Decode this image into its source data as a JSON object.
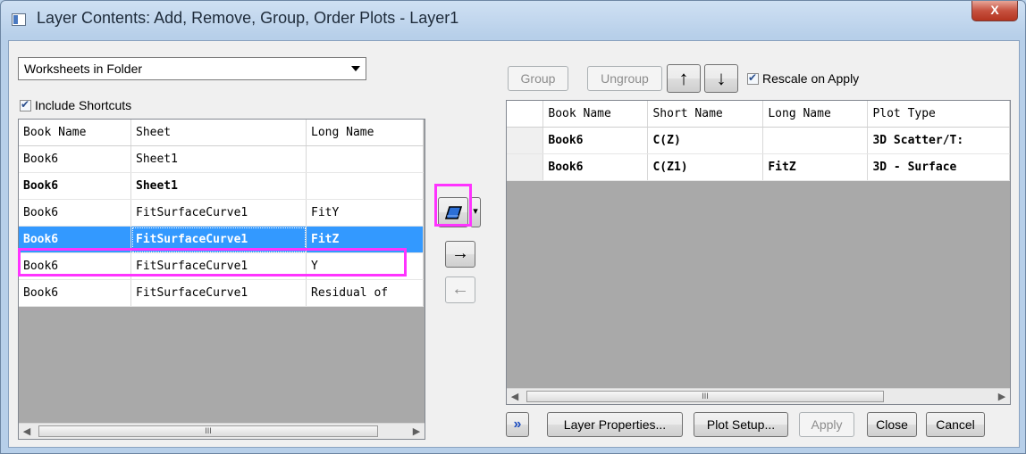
{
  "window": {
    "title": "Layer Contents: Add, Remove, Group, Order Plots - Layer1",
    "close_label": "X"
  },
  "left": {
    "source_select": "Worksheets in Folder",
    "include_shortcuts": {
      "label": "Include Shortcuts",
      "checked": true
    },
    "columns": [
      "Book Name",
      "Sheet",
      "Long Name"
    ],
    "rows": [
      [
        "Book6",
        "Sheet1",
        ""
      ],
      [
        "Book6",
        "Sheet1",
        ""
      ],
      [
        "Book6",
        "FitSurfaceCurve1",
        "FitY"
      ],
      [
        "Book6",
        "FitSurfaceCurve1",
        "FitZ"
      ],
      [
        "Book6",
        "FitSurfaceCurve1",
        "Y"
      ],
      [
        "Book6",
        "FitSurfaceCurve1",
        "Residual of"
      ]
    ],
    "scroll_grip": "III"
  },
  "middle": {
    "add_arrow": "→",
    "remove_arrow": "←",
    "dropdown_arrow": "▾",
    "plot_type_icon": "3d-surface-icon"
  },
  "right": {
    "group_label": "Group",
    "ungroup_label": "Ungroup",
    "up_arrow": "↑",
    "down_arrow": "↓",
    "rescale": {
      "label": "Rescale on Apply",
      "checked": true
    },
    "columns": [
      "Book Name",
      "Short Name",
      "Long Name",
      "Plot Type"
    ],
    "rows": [
      [
        "Book6",
        "C(Z)",
        "",
        "3D Scatter/T:"
      ],
      [
        "Book6",
        "C(Z1)",
        "FitZ",
        "3D - Surface"
      ]
    ],
    "scroll_grip": "III"
  },
  "footer": {
    "expand_label": "»",
    "layer_properties": "Layer Properties...",
    "plot_setup": "Plot Setup...",
    "apply": "Apply",
    "close": "Close",
    "cancel": "Cancel"
  },
  "highlight_color": "#ff33ff",
  "selection_color": "#3399ff"
}
